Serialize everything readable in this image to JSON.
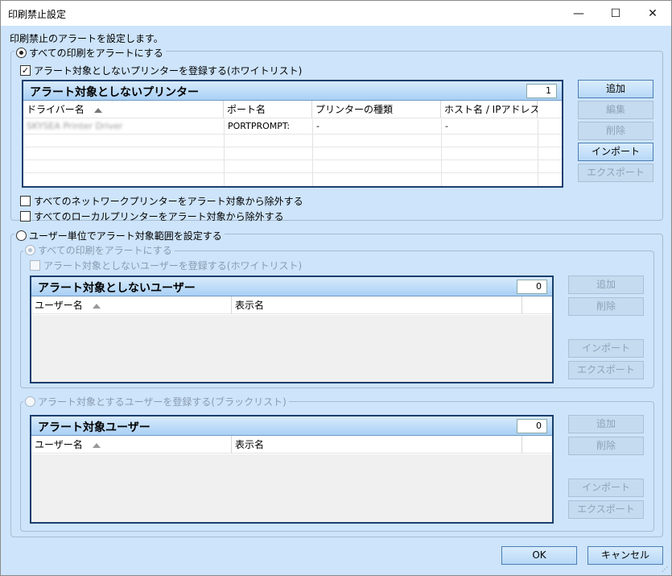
{
  "window": {
    "title": "印刷禁止設定",
    "minimize": "—",
    "maximize": "☐",
    "close": "✕"
  },
  "intro": "印刷禁止のアラートを設定します。",
  "section1": {
    "radio_label": "すべての印刷をアラートにする",
    "whitelist_checkbox": "アラート対象としないプリンターを登録する(ホワイトリスト)",
    "panel": {
      "title": "アラート対象としないプリンター",
      "count": "1",
      "columns": [
        "ドライバー名",
        "ポート名",
        "プリンターの種類",
        "ホスト名 / IPアドレス"
      ],
      "rows": [
        [
          "SKYSEA Printer Driver",
          "PORTPROMPT:",
          "-",
          "-"
        ]
      ]
    },
    "buttons": {
      "add": "追加",
      "edit": "編集",
      "delete": "削除",
      "import": "インポート",
      "export": "エクスポート"
    },
    "exclude_network": "すべてのネットワークプリンターをアラート対象から除外する",
    "exclude_local": "すべてのローカルプリンターをアラート対象から除外する"
  },
  "section2": {
    "radio_label": "ユーザー単位でアラート対象範囲を設定する",
    "sub1": {
      "radio_label": "すべての印刷をアラートにする",
      "checkbox": "アラート対象としないユーザーを登録する(ホワイトリスト)",
      "panel": {
        "title": "アラート対象としないユーザー",
        "count": "0",
        "columns": [
          "ユーザー名",
          "表示名"
        ]
      },
      "buttons": {
        "add": "追加",
        "delete": "削除",
        "import": "インポート",
        "export": "エクスポート"
      }
    },
    "sub2": {
      "radio_label": "アラート対象とするユーザーを登録する(ブラックリスト)",
      "panel": {
        "title": "アラート対象ユーザー",
        "count": "0",
        "columns": [
          "ユーザー名",
          "表示名"
        ]
      },
      "buttons": {
        "add": "追加",
        "delete": "削除",
        "import": "インポート",
        "export": "エクスポート"
      }
    }
  },
  "footer": {
    "ok": "OK",
    "cancel": "キャンセル"
  }
}
